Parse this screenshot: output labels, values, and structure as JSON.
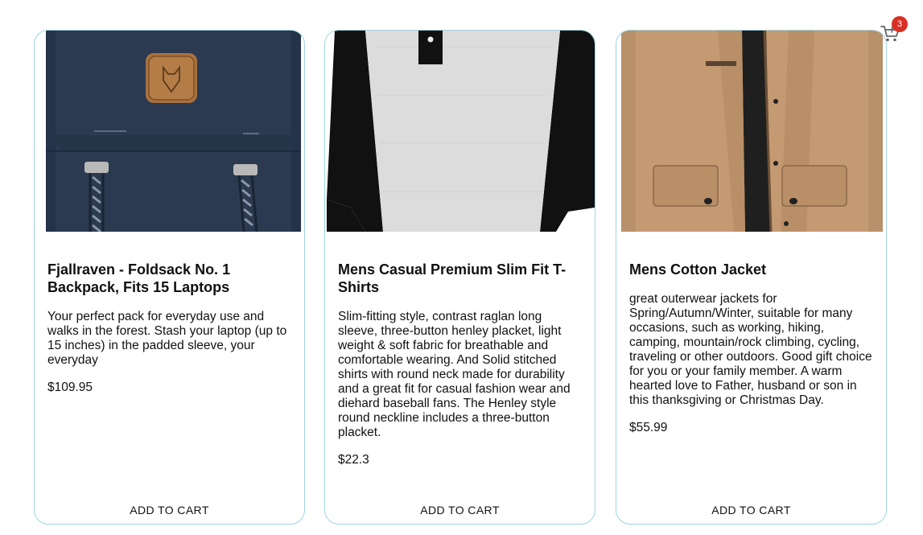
{
  "cart": {
    "icon": "shopping-cart-icon",
    "count": "3",
    "badge_color": "#d93025"
  },
  "accent_border_color": "#9fd5e2",
  "products": [
    {
      "title": "Fjallraven - Foldsack No. 1 Backpack, Fits 15 Laptops",
      "description": "Your perfect pack for everyday use and walks in the forest. Stash your laptop (up to 15 inches) in the padded sleeve, your everyday",
      "price": "$109.95",
      "button_label": "ADD TO CART",
      "image": "navy-backpack-image"
    },
    {
      "title": "Mens Casual Premium Slim Fit T-Shirts",
      "description": "Slim-fitting style, contrast raglan long sleeve, three-button henley placket, light weight & soft fabric for breathable and comfortable wearing. And Solid stitched shirts with round neck made for durability and a great fit for casual fashion wear and diehard baseball fans. The Henley style round neckline includes a three-button placket.",
      "price": "$22.3",
      "button_label": "ADD TO CART",
      "image": "raglan-henley-shirt-image"
    },
    {
      "title": "Mens Cotton Jacket",
      "description": "great outerwear jackets for Spring/Autumn/Winter, suitable for many occasions, such as working, hiking, camping, mountain/rock climbing, cycling, traveling or other outdoors. Good gift choice for you or your family member. A warm hearted love to Father, husband or son in this thanksgiving or Christmas Day.",
      "price": "$55.99",
      "button_label": "ADD TO CART",
      "image": "tan-cotton-jacket-image"
    }
  ]
}
